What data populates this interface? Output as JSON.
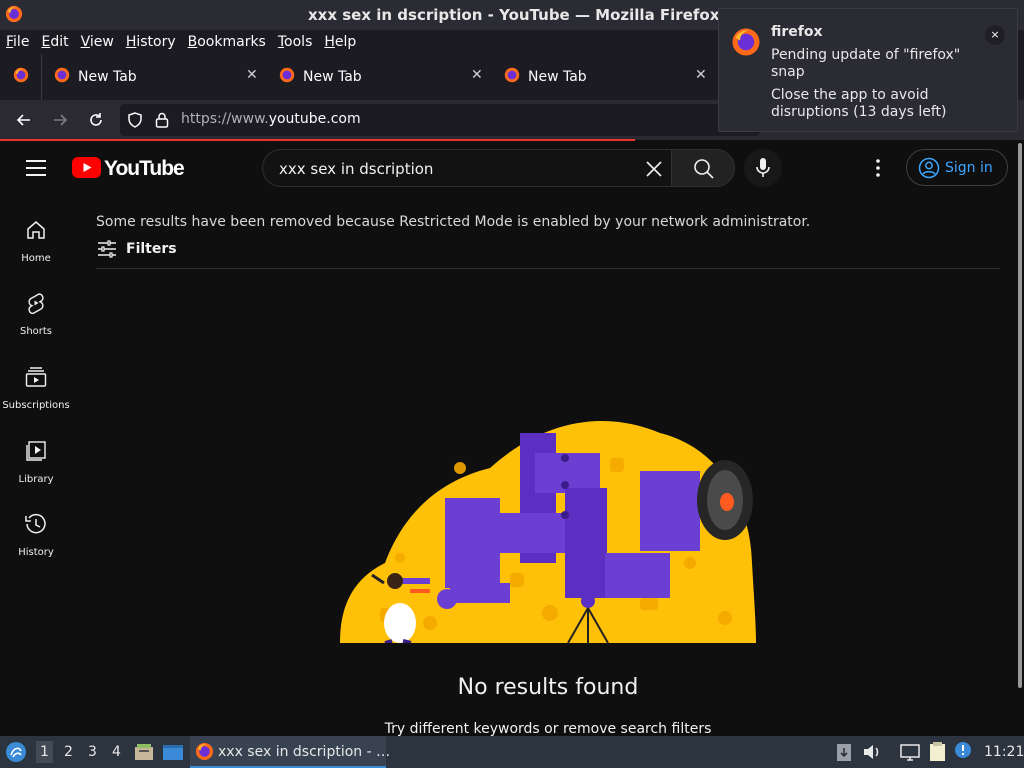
{
  "window": {
    "title": "xxx sex in dscription - YouTube — Mozilla Firefox"
  },
  "menubar": {
    "items": [
      {
        "first": "F",
        "rest": "ile"
      },
      {
        "first": "E",
        "rest": "dit"
      },
      {
        "first": "V",
        "rest": "iew"
      },
      {
        "first": "H",
        "rest": "istory"
      },
      {
        "first": "B",
        "rest": "ookmarks"
      },
      {
        "first": "T",
        "rest": "ools"
      },
      {
        "first": "H",
        "rest": "elp"
      }
    ]
  },
  "tabs": [
    {
      "label": "New Tab"
    },
    {
      "label": "New Tab"
    },
    {
      "label": "New Tab"
    }
  ],
  "urlbar": {
    "url_prefix": "https://www.",
    "url_host": "youtube.com"
  },
  "notification": {
    "app": "firefox",
    "line1": "Pending update of \"firefox\" snap",
    "line2": "Close the app to avoid disruptions (13 days left)",
    "close": "×"
  },
  "youtube": {
    "logo_text": "YouTube",
    "search_value": "xxx sex in dscription",
    "sign_in": "Sign in",
    "guide": [
      {
        "label": "Home",
        "icon": "home-icon"
      },
      {
        "label": "Shorts",
        "icon": "shorts-icon"
      },
      {
        "label": "Subscriptions",
        "icon": "subscriptions-icon"
      },
      {
        "label": "Library",
        "icon": "library-icon"
      },
      {
        "label": "History",
        "icon": "history-icon"
      }
    ],
    "restricted_notice": "Some results have been removed because Restricted Mode is enabled by your network administrator.",
    "filters_label": "Filters",
    "no_results": "No results found",
    "no_results_hint": "Try different keywords or remove search filters"
  },
  "taskbar": {
    "workspaces": [
      "1",
      "2",
      "3",
      "4"
    ],
    "active_workspace": "1",
    "app_label": "xxx sex in dscription - …",
    "clock": "11:21"
  },
  "colors": {
    "yt_red": "#ff0000",
    "link_blue": "#3ea6ff",
    "illus_yellow": "#ffc107",
    "illus_purple": "#6b3fd1"
  }
}
